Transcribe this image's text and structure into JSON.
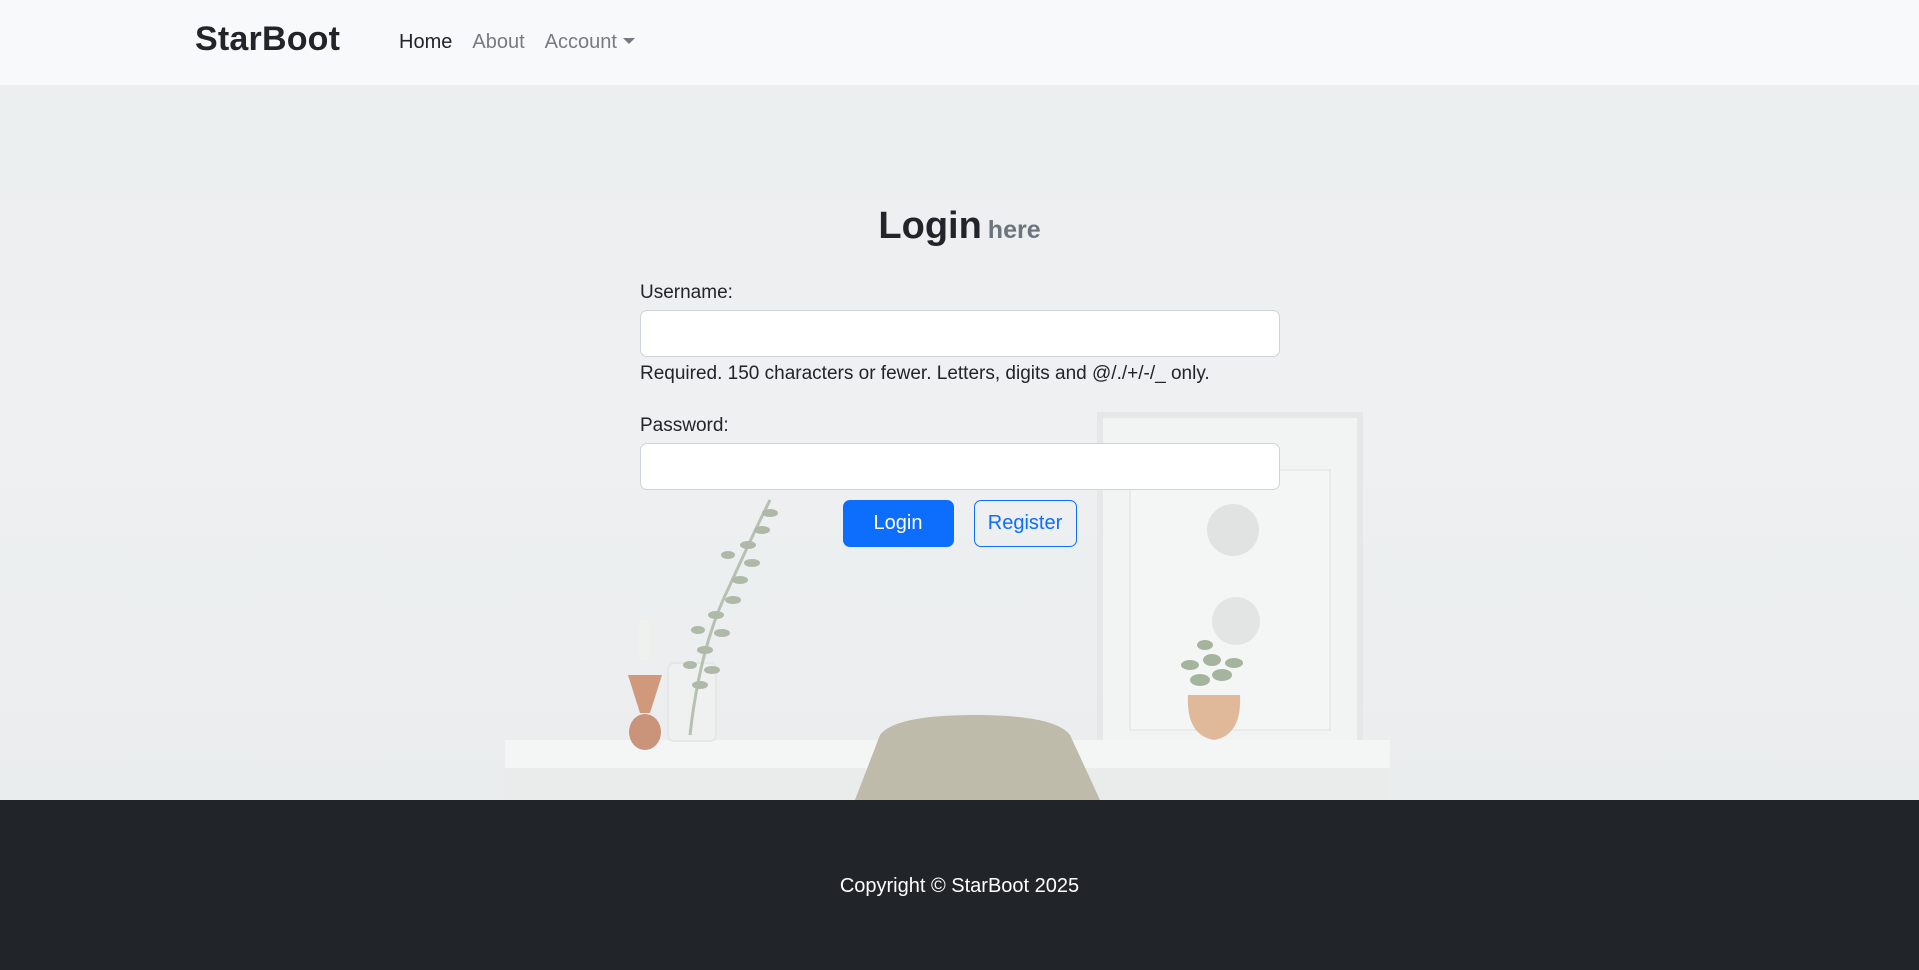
{
  "navbar": {
    "brand": "StarBoot",
    "links": [
      {
        "label": "Home"
      },
      {
        "label": "About"
      },
      {
        "label": "Account"
      }
    ]
  },
  "login": {
    "title": "Login",
    "subtitle": "here",
    "username_label": "Username:",
    "username_value": "",
    "username_help": "Required. 150 characters or fewer. Letters, digits and @/./+/-/_ only.",
    "password_label": "Password:",
    "password_value": "",
    "login_button": "Login",
    "register_button": "Register"
  },
  "footer": {
    "copyright": "Copyright © StarBoot 2025"
  },
  "colors": {
    "primary": "#0d6efd",
    "footer_bg": "#212529",
    "navbar_bg": "#f8f9fa"
  }
}
